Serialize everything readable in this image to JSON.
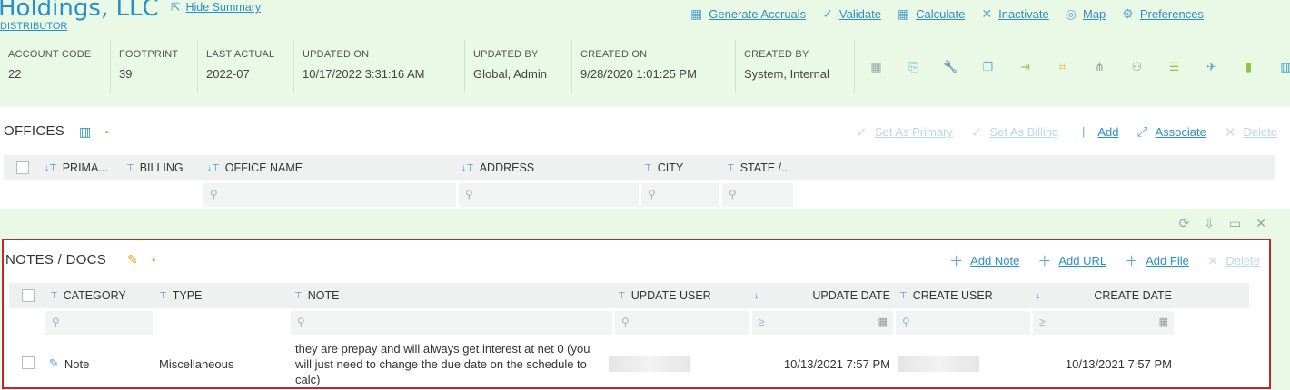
{
  "header": {
    "title": "Holdings, LLC",
    "subtitle": "DISTRIBUTOR",
    "hide_summary": "Hide Summary",
    "actions": [
      {
        "icon": "calculator-icon",
        "label": "Generate Accruals"
      },
      {
        "icon": "check-icon",
        "label": "Validate"
      },
      {
        "icon": "calculator-icon",
        "label": "Calculate"
      },
      {
        "icon": "x-icon",
        "label": "Inactivate"
      },
      {
        "icon": "compass-icon",
        "label": "Map"
      },
      {
        "icon": "gear-icon",
        "label": "Preferences"
      }
    ]
  },
  "summary": [
    {
      "key": "ACCOUNT CODE",
      "value": "22"
    },
    {
      "key": "FOOTPRINT",
      "value": "39"
    },
    {
      "key": "LAST ACTUAL",
      "value": "2022-07"
    },
    {
      "key": "UPDATED ON",
      "value": "10/17/2022 3:31:16 AM"
    },
    {
      "key": "UPDATED BY",
      "value": "Global, Admin"
    },
    {
      "key": "CREATED ON",
      "value": "9/28/2020 1:01:25 PM"
    },
    {
      "key": "CREATED BY",
      "value": "System, Internal"
    }
  ],
  "offices": {
    "title": "OFFICES",
    "actions": {
      "set_primary": "Set As Primary",
      "set_billing": "Set As Billing",
      "add": "Add",
      "associate": "Associate",
      "delete": "Delete"
    },
    "columns": [
      "PRIMA...",
      "BILLING",
      "OFFICE NAME",
      "ADDRESS",
      "CITY",
      "STATE /..."
    ]
  },
  "notes": {
    "title": "NOTES / DOCS",
    "actions": {
      "add_note": "Add Note",
      "add_url": "Add URL",
      "add_file": "Add File",
      "delete": "Delete"
    },
    "columns": [
      "CATEGORY",
      "TYPE",
      "NOTE",
      "UPDATE USER",
      "UPDATE DATE",
      "CREATE USER",
      "CREATE DATE"
    ],
    "row": {
      "category": "Note",
      "type": "Miscellaneous",
      "note": "they are prepay and will always get interest at net 0 (you will just need to change the due date on the schedule to calc)",
      "update_date": "10/13/2021 7:57 PM",
      "create_date": "10/13/2021 7:57 PM"
    }
  },
  "colors": {
    "accent": "#2b8fc7",
    "highlight_border": "#c0262d",
    "page_bg": "#eaf8e6"
  }
}
